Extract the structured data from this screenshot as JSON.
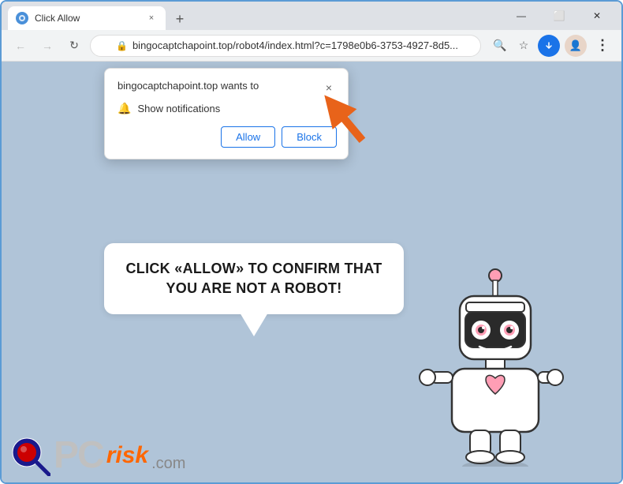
{
  "browser": {
    "title": "Click Allow",
    "tab": {
      "favicon_color": "#4a90d9",
      "title": "Click Allow",
      "close_label": "×"
    },
    "new_tab_label": "+",
    "window_controls": {
      "minimize": "—",
      "maximize": "⬜",
      "close": "✕"
    },
    "address_bar": {
      "back_label": "←",
      "forward_label": "→",
      "refresh_label": "↻",
      "lock_icon": "🔒",
      "url": "bingocaptchapoint.top/robot4/index.html?c=1798e0b6-3753-4927-8d5...",
      "search_icon": "🔍",
      "star_icon": "☆",
      "profile_icon": "👤",
      "menu_icon": "⋮",
      "download_icon": "⬇"
    }
  },
  "notification_popup": {
    "site_text": "bingocaptchapoint.top wants to",
    "close_label": "×",
    "bell_icon": "🔔",
    "permission_text": "Show notifications",
    "allow_label": "Allow",
    "block_label": "Block"
  },
  "speech_bubble": {
    "text": "CLICK «ALLOW» TO CONFIRM THAT YOU ARE NOT A ROBOT!"
  },
  "logo": {
    "pc_text": "PC",
    "risk_text": "risk",
    "com_text": ".com"
  }
}
